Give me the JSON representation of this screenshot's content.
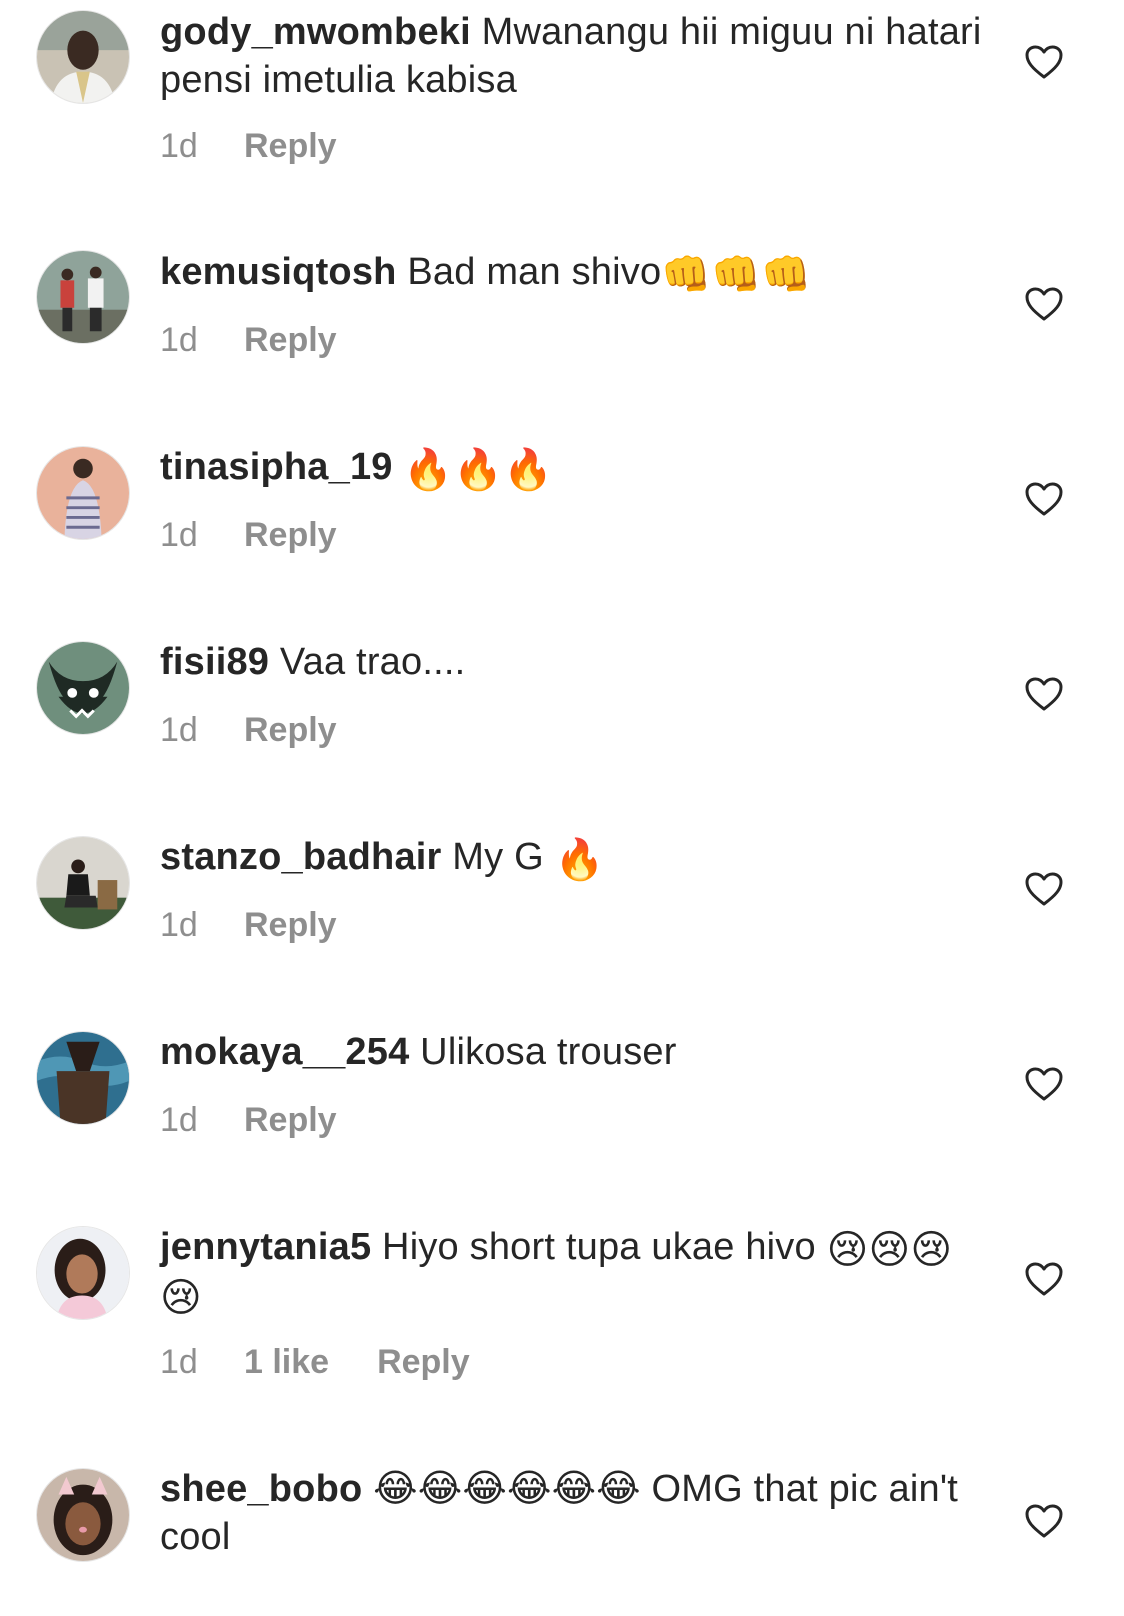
{
  "comments": [
    {
      "username": "gody_mwombeki",
      "text": "Mwanangu hii miguu ni hatari pensi imetulia kabisa",
      "emoji": "",
      "time": "1d",
      "likes": "",
      "reply_label": "Reply",
      "avatar_icon": "man-portrait-avatar"
    },
    {
      "username": "kemusiqtosh",
      "text": "Bad man shivo",
      "emoji": "👊👊👊",
      "time": "1d",
      "likes": "",
      "reply_label": "Reply",
      "avatar_icon": "two-people-avatar"
    },
    {
      "username": "tinasipha_19",
      "text": "",
      "emoji": "🔥🔥🔥",
      "time": "1d",
      "likes": "",
      "reply_label": "Reply",
      "avatar_icon": "woman-dress-avatar"
    },
    {
      "username": "fisii89",
      "text": "Vaa trao....",
      "emoji": "",
      "time": "1d",
      "likes": "",
      "reply_label": "Reply",
      "avatar_icon": "monster-avatar"
    },
    {
      "username": "stanzo_badhair",
      "text": "My G",
      "emoji": "🔥",
      "time": "1d",
      "likes": "",
      "reply_label": "Reply",
      "avatar_icon": "seated-man-avatar"
    },
    {
      "username": "mokaya__254",
      "text": "Ulikosa trouser",
      "emoji": "",
      "time": "1d",
      "likes": "",
      "reply_label": "Reply",
      "avatar_icon": "pool-person-avatar"
    },
    {
      "username": "jennytania5",
      "text": "Hiyo short tupa ukae hivo",
      "emoji": "😢😢😢😢",
      "time": "1d",
      "likes": "1 like",
      "reply_label": "Reply",
      "avatar_icon": "woman-selfie-avatar"
    },
    {
      "username": "shee_bobo",
      "text": "😂😂😂😂😂😂 OMG that pic ain't cool",
      "emoji": "",
      "time": "",
      "likes": "",
      "reply_label": "",
      "avatar_icon": "cat-filter-avatar"
    }
  ],
  "colors": {
    "text": "#262626",
    "meta": "#8e8e8e",
    "heart_outline": "#262626"
  }
}
